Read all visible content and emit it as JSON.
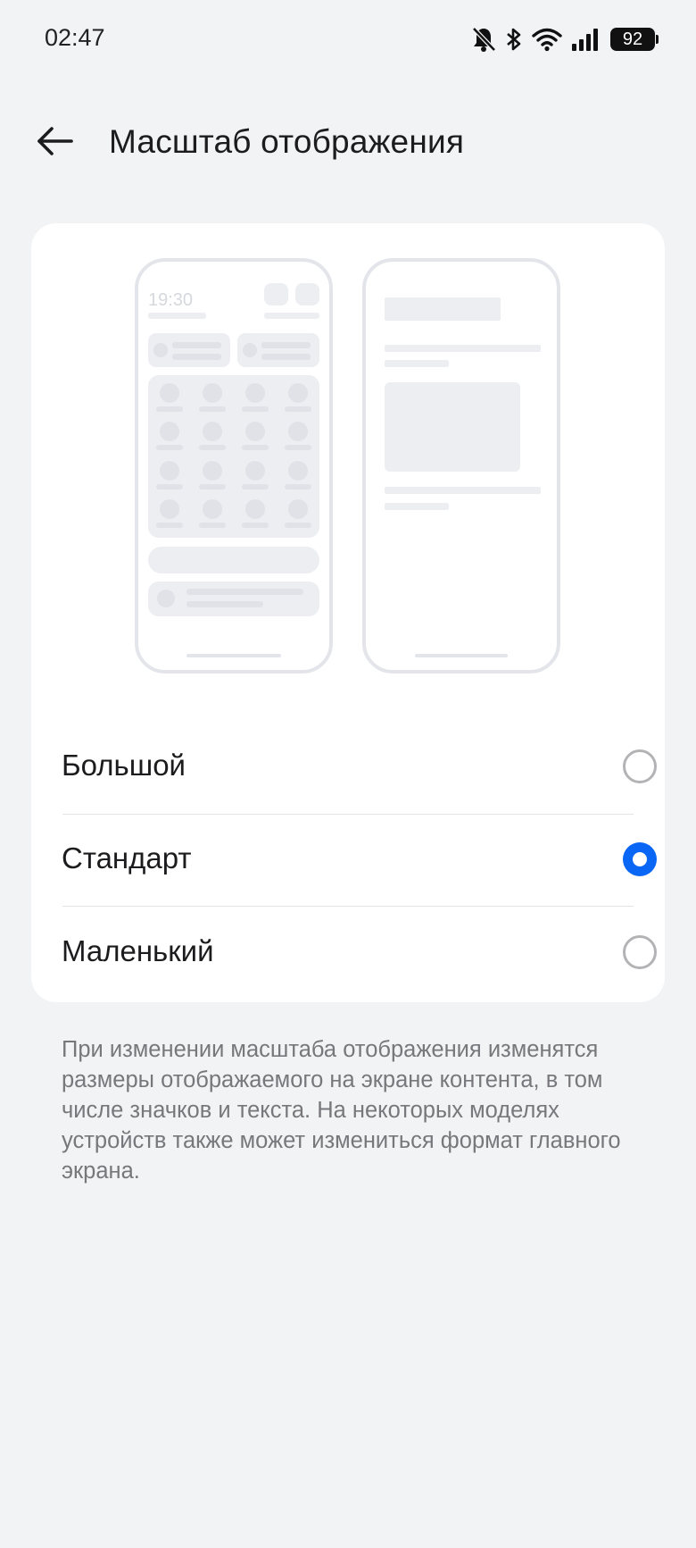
{
  "status_bar": {
    "time": "02:47",
    "battery": "92",
    "icons": [
      "bell-off-icon",
      "bluetooth-icon",
      "wifi-icon",
      "signal-icon",
      "battery-icon"
    ]
  },
  "header": {
    "back_icon": "arrow-left-icon",
    "title": "Масштаб отображения"
  },
  "preview": {
    "phone_time": "19:30"
  },
  "options": [
    {
      "label": "Большой",
      "selected": false
    },
    {
      "label": "Стандарт",
      "selected": true
    },
    {
      "label": "Маленький",
      "selected": false
    }
  ],
  "description": "При изменении масштаба отображения изменятся размеры отображаемого на экране контента, в том числе значков и текста. На некоторых моделях устройств также может измениться формат главного экрана.",
  "colors": {
    "background": "#f2f3f5",
    "card": "#ffffff",
    "accent": "#0a66f5",
    "mock_outline": "#e3e5ea",
    "mock_fill": "#eceef1"
  }
}
